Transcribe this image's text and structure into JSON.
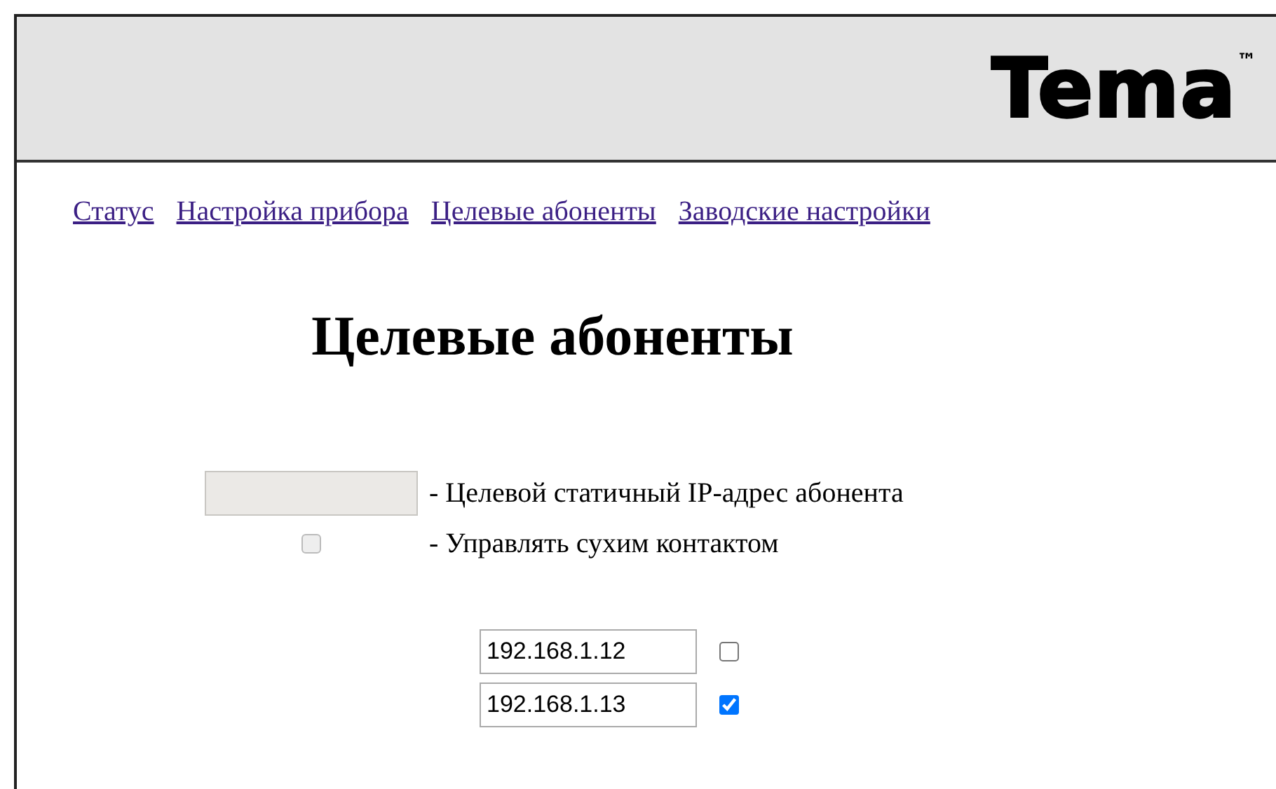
{
  "header": {
    "logo": "Tema",
    "trademark": "™"
  },
  "nav": [
    {
      "label": "Статус"
    },
    {
      "label": "Настройка прибора"
    },
    {
      "label": "Целевые абоненты"
    },
    {
      "label": "Заводские настройки"
    }
  ],
  "title": "Целевые абоненты",
  "legend": [
    {
      "kind": "field",
      "text": "- Целевой статичный IP-адрес абонента",
      "disabled": true
    },
    {
      "kind": "checkbox",
      "text": "- Управлять сухим контактом",
      "disabled": true
    }
  ],
  "subscribers": [
    {
      "ip": "192.168.1.12",
      "checked": false
    },
    {
      "ip": "192.168.1.13",
      "checked": true
    }
  ]
}
